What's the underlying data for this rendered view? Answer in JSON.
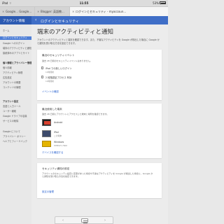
{
  "status_bar": {
    "device": "iPad",
    "time": "11:55",
    "battery": "53%"
  },
  "tabs": [
    {
      "label": "Google... Google...",
      "active": false
    },
    {
      "label": "Blogger: 英語教...",
      "active": false
    },
    {
      "label": "ログインとセキュリティ - myaccoun...",
      "active": true
    }
  ],
  "app_bar": {
    "sidebar_title": "アカウント情報",
    "chevron": "‹",
    "page": "ログインとセキュリティ"
  },
  "sidebar": {
    "items": [
      {
        "label": "ホーム",
        "type": "head"
      },
      {
        "label": "ログインとセキュリティ",
        "type": "active"
      },
      {
        "label": "Google へのログイン",
        "type": "item"
      },
      {
        "label": "端末のアクティビティと通知",
        "type": "item"
      },
      {
        "label": "接続済みのアプリとサイト",
        "type": "item"
      },
      {
        "label": "個人情報とプライバシー管理",
        "type": "head"
      },
      {
        "label": "個人情報",
        "type": "item"
      },
      {
        "label": "アクティビティ管理",
        "type": "item"
      },
      {
        "label": "広告設定",
        "type": "item"
      },
      {
        "label": "アカウントの概要",
        "type": "item"
      },
      {
        "label": "コンテンツの管理",
        "type": "item"
      },
      {
        "label": "アカウント設定",
        "type": "head"
      },
      {
        "label": "言語と入力ツール",
        "type": "item"
      },
      {
        "label": "ユーザー補助",
        "type": "item"
      },
      {
        "label": "Google ドライブの容量",
        "type": "item"
      },
      {
        "label": "サービスの削除",
        "type": "item"
      },
      {
        "label": "Google について",
        "type": "item"
      },
      {
        "label": "プライバシー ポリシー",
        "type": "item"
      },
      {
        "label": "ヘルプとフィードバック",
        "type": "item"
      }
    ]
  },
  "main": {
    "title": "端末のアクティビティと通知",
    "intro": "アカウントのアクティビティと端末を確認できます。また、不審なアクティビティを Google が検出した場合に Google から通知を受け取る方法を設定できます。",
    "security_events": {
      "title": "最近のセキュリティイベント",
      "desc": "過去 28 日間のセキュリティイベントはありません。",
      "events": [
        {
          "name": "iPad での新しいログイン",
          "time": "11時間前"
        },
        {
          "name": "2 段階認証プロセス 有効",
          "time": "11時間前"
        }
      ],
      "link": "イベントの確認"
    },
    "devices": {
      "title": "最近使用した端末",
      "desc": "過去 28 日間にアカウントにアクセスした端末と場所を確認できます。",
      "items": [
        {
          "name": "Android",
          "sub": "",
          "color": "#d9412f"
        },
        {
          "name": "iPad",
          "sub": "この端末",
          "color": "#5b6f96"
        },
        {
          "name": "Windows",
          "sub": "HPENVY-7600",
          "color": "#e4b400"
        }
      ],
      "link": "デバイスを確認する"
    },
    "alerts": {
      "title": "セキュリティ通知の設定",
      "desc": "アカウントのセキュリティ設定に変更があった場合や不審なアクティビティを Google が検出した場合に、Google から通知を受け取る方法を指定できます。",
      "link": "設定の管理"
    }
  },
  "bottom_bar": {
    "back": "‹",
    "forward": "›"
  },
  "colors": {
    "accent": "#3f6ec7",
    "link": "#2f66d0",
    "active_nav": "#4f7fd6"
  }
}
